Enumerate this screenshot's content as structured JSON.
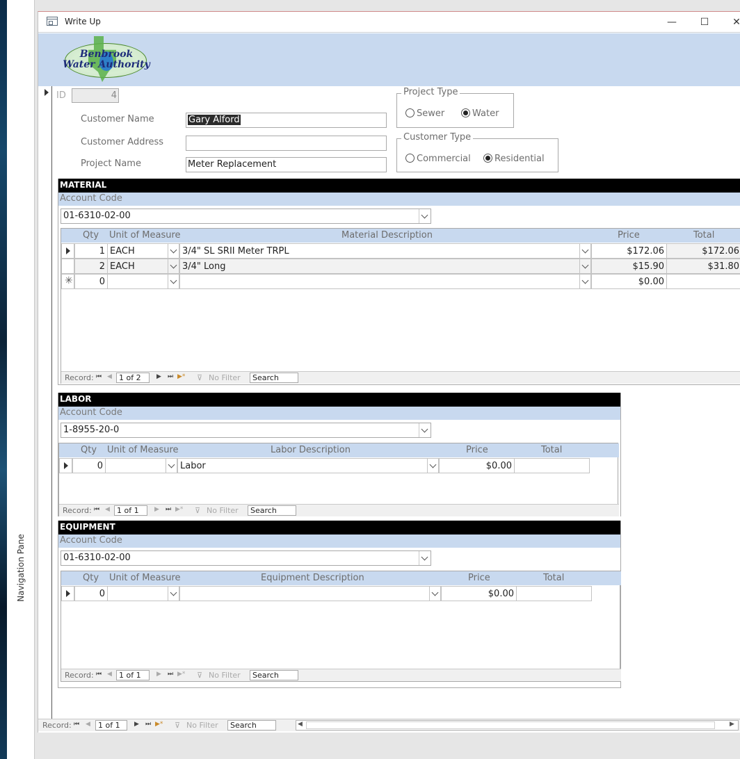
{
  "nav_pane": {
    "label": "Navigation Pane"
  },
  "window": {
    "title": "Write Up",
    "min": "—",
    "max": "☐",
    "close": "✕"
  },
  "logo": {
    "line1": "Benbrook",
    "line2": "Water Authority"
  },
  "form": {
    "id_label": "ID",
    "id_value": "4",
    "customer_name_label": "Customer Name",
    "customer_name": "Gary Alford",
    "customer_address_label": "Customer Address",
    "customer_address": "",
    "project_name_label": "Project Name",
    "project_name": "Meter Replacement",
    "project_type": {
      "legend": "Project Type",
      "options": [
        "Sewer",
        "Water"
      ],
      "selected": "Water"
    },
    "customer_type": {
      "legend": "Customer Type",
      "options": [
        "Commercial",
        "Residential"
      ],
      "selected": "Residential"
    }
  },
  "material": {
    "title": "MATERIAL",
    "account_label": "Account Code",
    "account_code": "01-6310-02-00",
    "columns": [
      "Qty",
      "Unit of Measure",
      "Material Description",
      "Price",
      "Total"
    ],
    "rows": [
      {
        "qty": "1",
        "unit": "EACH",
        "desc": "3/4\" SL SRII Meter TRPL",
        "price": "$172.06",
        "total": "$172.06"
      },
      {
        "qty": "2",
        "unit": "EACH",
        "desc": "3/4\" Long",
        "price": "$15.90",
        "total": "$31.80"
      },
      {
        "qty": "0",
        "unit": "",
        "desc": "",
        "price": "$0.00",
        "total": ""
      }
    ],
    "nav": {
      "record_label": "Record:",
      "position": "1 of 2",
      "filter": "No Filter",
      "search": "Search"
    }
  },
  "labor": {
    "title": "LABOR",
    "account_label": "Account Code",
    "account_code": "1-8955-20-0",
    "columns": [
      "Qty",
      "Unit of Measure",
      "Labor Description",
      "Price",
      "Total"
    ],
    "rows": [
      {
        "qty": "0",
        "unit": "",
        "desc": "Labor",
        "price": "$0.00",
        "total": ""
      }
    ],
    "nav": {
      "record_label": "Record:",
      "position": "1 of 1",
      "filter": "No Filter",
      "search": "Search"
    }
  },
  "equipment": {
    "title": "EQUIPMENT",
    "account_label": "Account Code",
    "account_code": "01-6310-02-00",
    "columns": [
      "Qty",
      "Unit of Measure",
      "Equipment Description",
      "Price",
      "Total"
    ],
    "rows": [
      {
        "qty": "0",
        "unit": "",
        "desc": "",
        "price": "$0.00",
        "total": ""
      }
    ],
    "nav": {
      "record_label": "Record:",
      "position": "1 of 1",
      "filter": "No Filter",
      "search": "Search"
    }
  },
  "main_nav": {
    "record_label": "Record:",
    "position": "1 of 1",
    "filter": "No Filter",
    "search": "Search"
  },
  "icons": {
    "first": "⏮",
    "prev": "◀",
    "next": "▶",
    "last": "⏭",
    "new": "▶*",
    "filter": "filter-icon"
  }
}
